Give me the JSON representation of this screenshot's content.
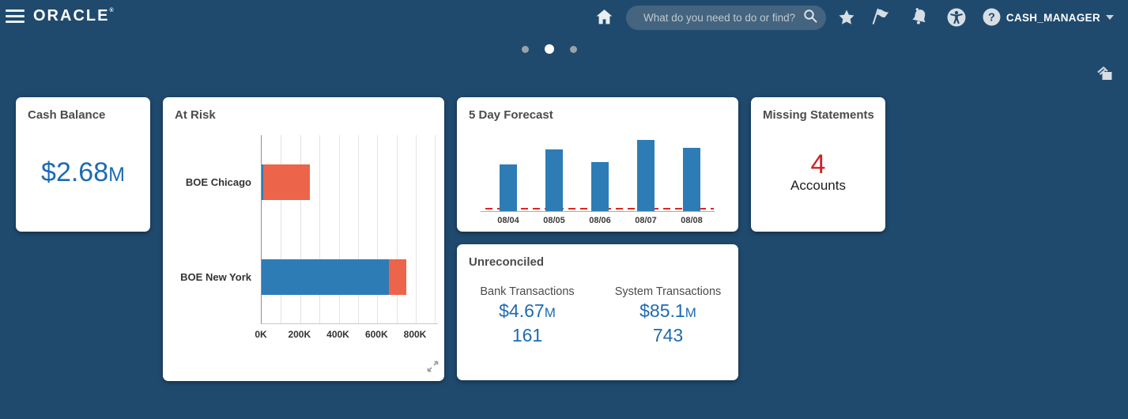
{
  "colors": {
    "background": "#1F4A6E",
    "card_bg": "#FFFFFF",
    "value_blue": "#1D6BB0",
    "alert_red": "#CD2026",
    "bar_blue": "#2E7CB5",
    "bar_orange": "#EC6449",
    "forecast_baseline_red": "#DF271C"
  },
  "header": {
    "logo_text": "ORACLE",
    "logo_mark": "®",
    "search_placeholder": "What do you need to do or find?",
    "user_menu_label": "CASH_MANAGER"
  },
  "carousel": {
    "dot_count": 3,
    "active_index": 1
  },
  "cards": {
    "cash_balance": {
      "title": "Cash Balance",
      "amount": "$2.68",
      "unit": "M"
    },
    "at_risk": {
      "title": "At Risk"
    },
    "forecast": {
      "title": "5 Day Forecast"
    },
    "missing_statements": {
      "title": "Missing Statements",
      "count": "4",
      "label": "Accounts"
    },
    "unreconciled": {
      "title": "Unreconciled",
      "columns": [
        {
          "label": "Bank Transactions",
          "amount": "$4.67",
          "unit": "M",
          "count": "161"
        },
        {
          "label": "System Transactions",
          "amount": "$85.1",
          "unit": "M",
          "count": "743"
        }
      ]
    }
  },
  "chart_data": [
    {
      "name": "at_risk",
      "type": "bar",
      "orientation": "horizontal",
      "stacked": true,
      "title": "At Risk",
      "categories": [
        "BOE Chicago",
        "BOE New York"
      ],
      "series": [
        {
          "name": "balance",
          "color": "#2E7CB5",
          "values": [
            10000,
            660000
          ]
        },
        {
          "name": "at-risk",
          "color": "#EC6449",
          "values": [
            240000,
            90000
          ]
        }
      ],
      "xlim": [
        0,
        800000
      ],
      "x_ticks": [
        {
          "value": 0,
          "label": "0K"
        },
        {
          "value": 200000,
          "label": "200K"
        },
        {
          "value": 400000,
          "label": "400K"
        },
        {
          "value": 600000,
          "label": "600K"
        },
        {
          "value": 800000,
          "label": "800K"
        }
      ],
      "gridline_step": 100000,
      "grid": true,
      "legend": "none"
    },
    {
      "name": "five_day_forecast",
      "type": "bar",
      "orientation": "vertical",
      "title": "5 Day Forecast",
      "categories": [
        "08/04",
        "08/05",
        "08/06",
        "08/07",
        "08/08"
      ],
      "values": [
        66,
        87,
        69,
        100,
        89
      ],
      "value_note": "relative heights, no y-axis labels shown; max bar = 100",
      "bar_color": "#2E7CB5",
      "baseline": "red dashed zero line over gray axis line",
      "legend": "none"
    }
  ]
}
